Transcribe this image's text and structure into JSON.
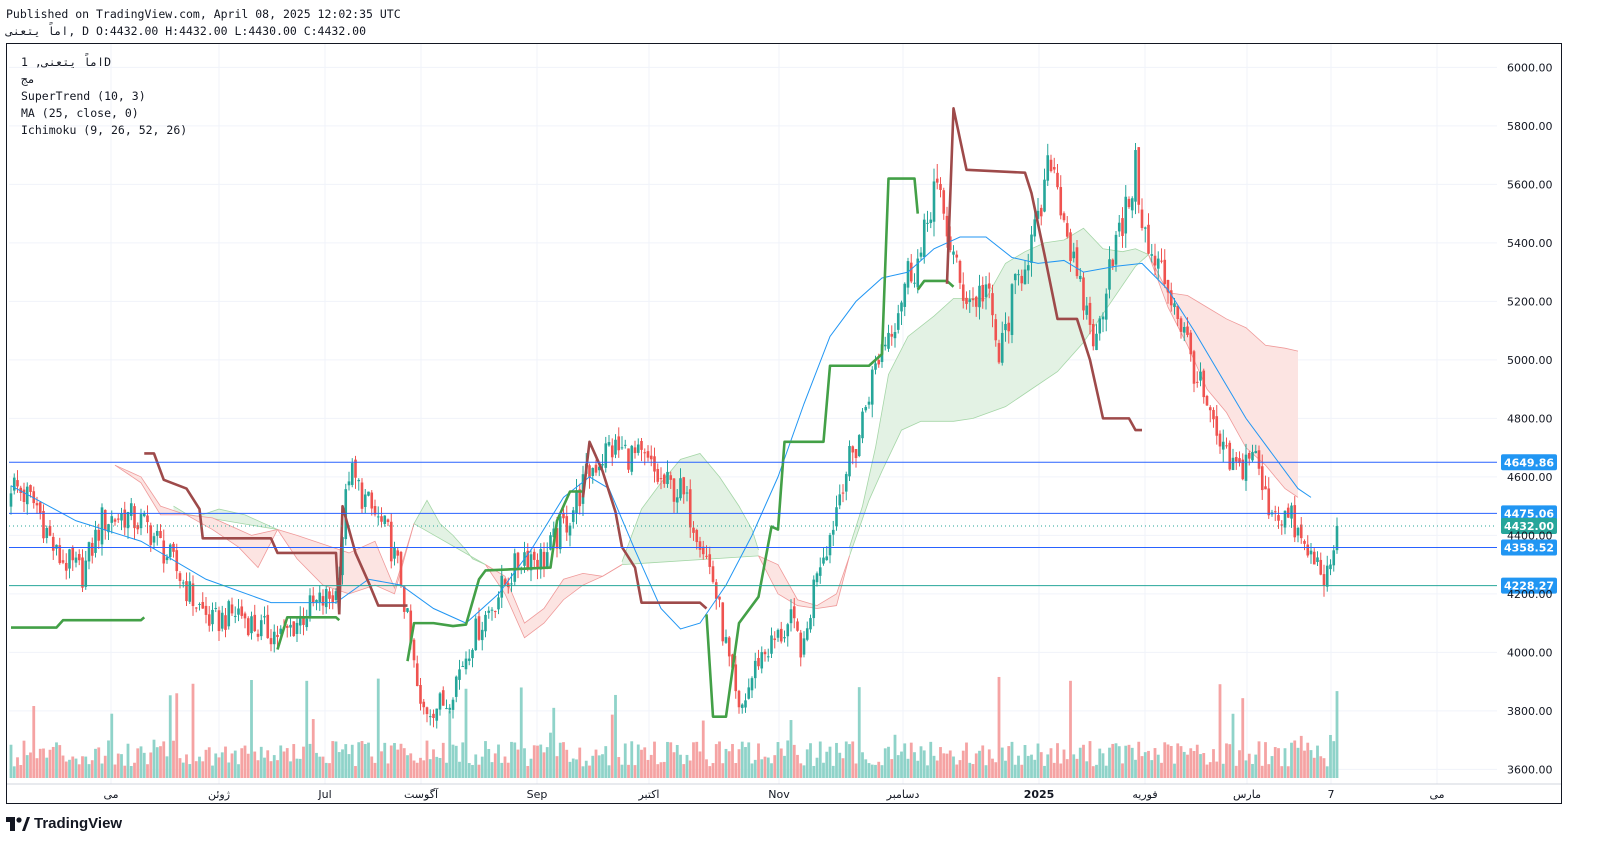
{
  "header": {
    "published": "Published on TradingView.com, April 08, 2025 12:02:35 UTC",
    "ohlc": "اماً يتعنى, D O:4432.00 H:4432.00 L:4430.00 C:4432.00"
  },
  "legend": {
    "symbol": "اماً يتعنى, 1D",
    "sub": "مج",
    "supertrend": "SuperTrend (10, 3)",
    "ma": "MA (25, close, 0)",
    "ichimoku": "Ichimoku (9, 26, 52, 26)"
  },
  "footer": {
    "brand": "TradingView"
  },
  "colors": {
    "up": "#26a69a",
    "down": "#ef5350",
    "vol_up": "#8fd3c9",
    "vol_down": "#f5a3a3",
    "supertrend_up": "#43a047",
    "supertrend_down": "#9e4a4a",
    "ma": "#2196f3",
    "cloud_bull": "#e3f2e4",
    "cloud_bear": "#fce4e2",
    "hline": "#2962ff",
    "label_bg": "#2196f3",
    "last_bg": "#26a69a"
  },
  "chart_data": {
    "type": "candlestick",
    "timeframe": "1D",
    "ylim": [
      3550,
      6080
    ],
    "y_ticks": [
      3600,
      3800,
      4000,
      4200,
      4400,
      4600,
      4800,
      5000,
      5200,
      5400,
      5600,
      5800,
      6000
    ],
    "x_labels": [
      "می",
      "ژوئن",
      "Jul",
      "آگوست",
      "Sep",
      "اکتبر",
      "Nov",
      "دسامبر",
      "2025",
      "فوریه",
      "مارس",
      "7",
      "می"
    ],
    "x_label_bold": [
      false,
      false,
      false,
      false,
      false,
      false,
      false,
      false,
      true,
      false,
      false,
      false,
      false
    ],
    "price_lines": [
      {
        "label": "4649.86",
        "value": 4649.86,
        "color": "#2962ff"
      },
      {
        "label": "4475.06",
        "value": 4475.06,
        "color": "#2962ff"
      },
      {
        "label": "4432.00",
        "value": 4432.0,
        "color": "#26a69a",
        "last": true
      },
      {
        "label": "4358.52",
        "value": 4358.52,
        "color": "#2962ff"
      },
      {
        "label": "4228.27",
        "value": 4228.27,
        "color": "#26a69a"
      }
    ],
    "close_anchors": [
      [
        0,
        4580
      ],
      [
        8,
        4500
      ],
      [
        14,
        4330
      ],
      [
        22,
        4270
      ],
      [
        28,
        4450
      ],
      [
        35,
        4470
      ],
      [
        42,
        4430
      ],
      [
        50,
        4300
      ],
      [
        56,
        4180
      ],
      [
        62,
        4100
      ],
      [
        70,
        4140
      ],
      [
        76,
        4080
      ],
      [
        84,
        4060
      ],
      [
        92,
        4150
      ],
      [
        100,
        4200
      ],
      [
        104,
        4620
      ],
      [
        110,
        4500
      ],
      [
        116,
        4400
      ],
      [
        120,
        4250
      ],
      [
        126,
        3800
      ],
      [
        134,
        3830
      ],
      [
        142,
        4050
      ],
      [
        150,
        4200
      ],
      [
        158,
        4340
      ],
      [
        164,
        4320
      ],
      [
        172,
        4470
      ],
      [
        178,
        4620
      ],
      [
        184,
        4700
      ],
      [
        190,
        4680
      ],
      [
        196,
        4640
      ],
      [
        200,
        4580
      ],
      [
        206,
        4550
      ],
      [
        212,
        4400
      ],
      [
        216,
        4250
      ],
      [
        220,
        4020
      ],
      [
        224,
        3780
      ],
      [
        230,
        3980
      ],
      [
        236,
        4050
      ],
      [
        240,
        4100
      ],
      [
        244,
        4000
      ],
      [
        248,
        4300
      ],
      [
        252,
        4400
      ],
      [
        256,
        4600
      ],
      [
        260,
        4700
      ],
      [
        264,
        4900
      ],
      [
        268,
        5050
      ],
      [
        272,
        5150
      ],
      [
        276,
        5300
      ],
      [
        280,
        5350
      ],
      [
        284,
        5600
      ],
      [
        288,
        5450
      ],
      [
        292,
        5250
      ],
      [
        296,
        5200
      ],
      [
        300,
        5250
      ],
      [
        304,
        5000
      ],
      [
        308,
        5200
      ],
      [
        312,
        5350
      ],
      [
        316,
        5450
      ],
      [
        320,
        5700
      ],
      [
        324,
        5500
      ],
      [
        328,
        5250
      ],
      [
        330,
        5200
      ],
      [
        334,
        5050
      ],
      [
        338,
        5350
      ],
      [
        342,
        5450
      ],
      [
        346,
        5650
      ],
      [
        350,
        5350
      ],
      [
        354,
        5300
      ],
      [
        358,
        5200
      ],
      [
        362,
        5050
      ],
      [
        366,
        4900
      ],
      [
        370,
        4750
      ],
      [
        374,
        4650
      ],
      [
        378,
        4620
      ],
      [
        382,
        4700
      ],
      [
        386,
        4520
      ],
      [
        390,
        4480
      ],
      [
        394,
        4450
      ],
      [
        398,
        4350
      ],
      [
        402,
        4300
      ],
      [
        406,
        4250
      ],
      [
        408,
        4432
      ]
    ],
    "candle_count": 409,
    "volume_scale_max": 4500,
    "ma_anchors": [
      [
        0,
        4570
      ],
      [
        20,
        4450
      ],
      [
        40,
        4380
      ],
      [
        60,
        4250
      ],
      [
        80,
        4170
      ],
      [
        100,
        4170
      ],
      [
        110,
        4250
      ],
      [
        120,
        4230
      ],
      [
        130,
        4150
      ],
      [
        140,
        4100
      ],
      [
        150,
        4200
      ],
      [
        160,
        4350
      ],
      [
        170,
        4530
      ],
      [
        178,
        4600
      ],
      [
        184,
        4560
      ],
      [
        192,
        4350
      ],
      [
        200,
        4150
      ],
      [
        206,
        4080
      ],
      [
        212,
        4100
      ],
      [
        220,
        4230
      ],
      [
        228,
        4400
      ],
      [
        236,
        4600
      ],
      [
        244,
        4850
      ],
      [
        252,
        5080
      ],
      [
        260,
        5200
      ],
      [
        268,
        5280
      ],
      [
        276,
        5300
      ],
      [
        284,
        5380
      ],
      [
        292,
        5420
      ],
      [
        300,
        5420
      ],
      [
        308,
        5350
      ],
      [
        316,
        5330
      ],
      [
        324,
        5340
      ],
      [
        330,
        5300
      ],
      [
        340,
        5320
      ],
      [
        348,
        5330
      ],
      [
        356,
        5240
      ],
      [
        364,
        5100
      ],
      [
        372,
        4950
      ],
      [
        380,
        4800
      ],
      [
        390,
        4650
      ],
      [
        396,
        4560
      ],
      [
        400,
        4530
      ]
    ],
    "supertrend_segments": [
      {
        "dir": "up",
        "points": [
          [
            0,
            4085
          ],
          [
            14,
            4085
          ],
          [
            16,
            4110
          ],
          [
            40,
            4110
          ],
          [
            41,
            4120
          ]
        ]
      },
      {
        "dir": "down",
        "points": [
          [
            41,
            4680
          ],
          [
            44,
            4680
          ],
          [
            47,
            4590
          ],
          [
            54,
            4560
          ],
          [
            58,
            4490
          ],
          [
            59,
            4390
          ],
          [
            80,
            4390
          ],
          [
            82,
            4340
          ],
          [
            100,
            4340
          ],
          [
            101,
            4130
          ]
        ]
      },
      {
        "dir": "up",
        "points": [
          [
            82,
            4010
          ],
          [
            85,
            4120
          ],
          [
            100,
            4120
          ],
          [
            101,
            4110
          ]
        ]
      },
      {
        "dir": "down",
        "points": [
          [
            101,
            4130
          ],
          [
            102,
            4500
          ],
          [
            106,
            4340
          ],
          [
            110,
            4240
          ],
          [
            113,
            4160
          ],
          [
            122,
            4160
          ]
        ]
      },
      {
        "dir": "up",
        "points": [
          [
            122,
            3970
          ],
          [
            124,
            4100
          ],
          [
            130,
            4100
          ],
          [
            136,
            4090
          ],
          [
            140,
            4095
          ],
          [
            144,
            4250
          ],
          [
            146,
            4280
          ],
          [
            166,
            4290
          ],
          [
            168,
            4450
          ],
          [
            172,
            4550
          ],
          [
            176,
            4550
          ]
        ]
      },
      {
        "dir": "down",
        "points": [
          [
            176,
            4530
          ],
          [
            178,
            4720
          ],
          [
            182,
            4620
          ],
          [
            186,
            4480
          ],
          [
            188,
            4360
          ],
          [
            192,
            4290
          ],
          [
            194,
            4170
          ],
          [
            212,
            4170
          ],
          [
            214,
            4150
          ]
        ]
      },
      {
        "dir": "up",
        "points": [
          [
            214,
            4130
          ],
          [
            216,
            3780
          ],
          [
            220,
            3780
          ],
          [
            224,
            4100
          ],
          [
            230,
            4190
          ],
          [
            234,
            4430
          ],
          [
            236,
            4420
          ],
          [
            238,
            4720
          ],
          [
            250,
            4720
          ],
          [
            252,
            4980
          ],
          [
            264,
            4980
          ],
          [
            268,
            5020
          ],
          [
            270,
            5620
          ],
          [
            278,
            5620
          ],
          [
            279,
            5500
          ]
        ]
      },
      {
        "dir": "up",
        "points": [
          [
            279,
            5240
          ],
          [
            281,
            5270
          ],
          [
            288,
            5270
          ],
          [
            290,
            5250
          ]
        ]
      },
      {
        "dir": "down",
        "points": [
          [
            288,
            5260
          ],
          [
            290,
            5860
          ],
          [
            294,
            5650
          ],
          [
            312,
            5640
          ],
          [
            314,
            5570
          ],
          [
            318,
            5360
          ],
          [
            322,
            5140
          ],
          [
            328,
            5140
          ],
          [
            332,
            5000
          ],
          [
            336,
            4800
          ],
          [
            344,
            4800
          ],
          [
            346,
            4760
          ],
          [
            348,
            4760
          ]
        ]
      }
    ],
    "cloud_bull": [
      [
        [
          50,
          4500
        ],
        [
          56,
          4460
        ],
        [
          64,
          4490
        ],
        [
          72,
          4470
        ],
        [
          78,
          4440
        ],
        [
          82,
          4420
        ]
      ],
      [
        [
          124,
          4440
        ],
        [
          128,
          4520
        ],
        [
          132,
          4440
        ],
        [
          136,
          4400
        ],
        [
          140,
          4350
        ],
        [
          142,
          4320
        ],
        [
          146,
          4300
        ]
      ],
      [
        [
          188,
          4310
        ],
        [
          194,
          4490
        ],
        [
          200,
          4580
        ],
        [
          206,
          4660
        ],
        [
          212,
          4680
        ],
        [
          218,
          4600
        ],
        [
          224,
          4500
        ],
        [
          228,
          4420
        ],
        [
          230,
          4350
        ]
      ],
      [
        [
          258,
          4360
        ],
        [
          262,
          4500
        ],
        [
          266,
          4700
        ],
        [
          270,
          4950
        ],
        [
          276,
          5080
        ],
        [
          284,
          5150
        ],
        [
          290,
          5210
        ],
        [
          300,
          5210
        ],
        [
          306,
          5330
        ],
        [
          312,
          5370
        ],
        [
          318,
          5400
        ],
        [
          324,
          5410
        ],
        [
          330,
          5450
        ],
        [
          336,
          5380
        ],
        [
          342,
          5370
        ],
        [
          346,
          5380
        ],
        [
          350,
          5360
        ]
      ]
    ],
    "cloud_bull_base": [
      [
        [
          50,
          4480
        ],
        [
          82,
          4420
        ]
      ],
      [
        [
          124,
          4440
        ],
        [
          146,
          4300
        ]
      ],
      [
        [
          188,
          4300
        ],
        [
          230,
          4330
        ]
      ],
      [
        [
          258,
          4330
        ],
        [
          264,
          4520
        ],
        [
          268,
          4620
        ],
        [
          274,
          4760
        ],
        [
          280,
          4790
        ],
        [
          290,
          4790
        ],
        [
          296,
          4800
        ],
        [
          306,
          4840
        ],
        [
          314,
          4900
        ],
        [
          322,
          4960
        ],
        [
          330,
          5060
        ],
        [
          338,
          5190
        ],
        [
          346,
          5320
        ],
        [
          350,
          5360
        ]
      ]
    ],
    "cloud_bear": [
      [
        [
          32,
          4640
        ],
        [
          36,
          4620
        ],
        [
          40,
          4600
        ],
        [
          46,
          4500
        ],
        [
          54,
          4470
        ],
        [
          62,
          4460
        ],
        [
          70,
          4420
        ],
        [
          74,
          4400
        ],
        [
          82,
          4420
        ]
      ],
      [
        [
          82,
          4420
        ],
        [
          88,
          4400
        ],
        [
          96,
          4370
        ],
        [
          104,
          4340
        ],
        [
          112,
          4380
        ],
        [
          118,
          4220
        ],
        [
          124,
          4440
        ]
      ],
      [
        [
          146,
          4300
        ],
        [
          152,
          4260
        ],
        [
          158,
          4100
        ],
        [
          164,
          4150
        ],
        [
          170,
          4250
        ],
        [
          176,
          4270
        ],
        [
          182,
          4260
        ],
        [
          188,
          4300
        ]
      ],
      [
        [
          230,
          4330
        ],
        [
          236,
          4300
        ],
        [
          242,
          4180
        ],
        [
          248,
          4160
        ],
        [
          254,
          4200
        ],
        [
          258,
          4330
        ]
      ],
      [
        [
          350,
          5360
        ],
        [
          356,
          5230
        ],
        [
          362,
          5220
        ],
        [
          368,
          5180
        ],
        [
          374,
          5140
        ],
        [
          380,
          5110
        ],
        [
          386,
          5050
        ],
        [
          392,
          5040
        ],
        [
          396,
          5030
        ]
      ]
    ],
    "cloud_bear_base": [
      [
        [
          32,
          4640
        ],
        [
          40,
          4580
        ],
        [
          46,
          4470
        ],
        [
          54,
          4470
        ],
        [
          62,
          4420
        ],
        [
          70,
          4360
        ],
        [
          76,
          4290
        ],
        [
          82,
          4420
        ]
      ],
      [
        [
          82,
          4420
        ],
        [
          88,
          4320
        ],
        [
          96,
          4230
        ],
        [
          104,
          4200
        ],
        [
          112,
          4230
        ],
        [
          118,
          4200
        ],
        [
          124,
          4440
        ]
      ],
      [
        [
          146,
          4300
        ],
        [
          152,
          4200
        ],
        [
          158,
          4050
        ],
        [
          164,
          4100
        ],
        [
          170,
          4180
        ],
        [
          176,
          4230
        ],
        [
          182,
          4260
        ],
        [
          188,
          4300
        ]
      ],
      [
        [
          230,
          4330
        ],
        [
          236,
          4200
        ],
        [
          242,
          4160
        ],
        [
          248,
          4150
        ],
        [
          254,
          4160
        ],
        [
          258,
          4330
        ]
      ],
      [
        [
          350,
          5360
        ],
        [
          356,
          5180
        ],
        [
          362,
          5050
        ],
        [
          368,
          4900
        ],
        [
          374,
          4820
        ],
        [
          380,
          4700
        ],
        [
          386,
          4640
        ],
        [
          392,
          4560
        ],
        [
          396,
          4530
        ]
      ]
    ]
  }
}
